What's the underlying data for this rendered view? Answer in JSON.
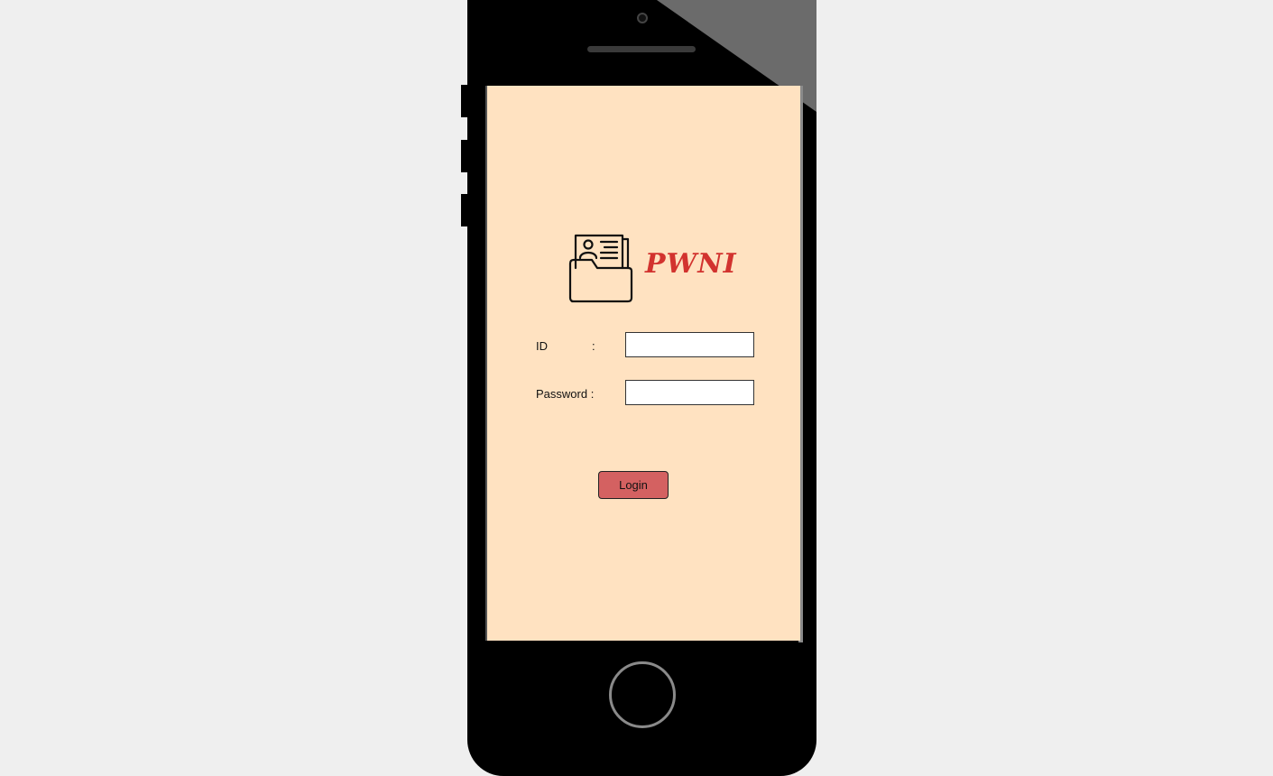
{
  "app": {
    "brand_name": "PWNI",
    "logo_icon": "contact-folder-icon",
    "brand_color": "#d2332f",
    "screen_background": "#ffe2c1"
  },
  "login_form": {
    "id_label": "ID",
    "id_colon": ":",
    "id_value": "",
    "password_label": "Password :",
    "password_value": "",
    "login_button_label": "Login",
    "login_button_color": "#d46161"
  }
}
